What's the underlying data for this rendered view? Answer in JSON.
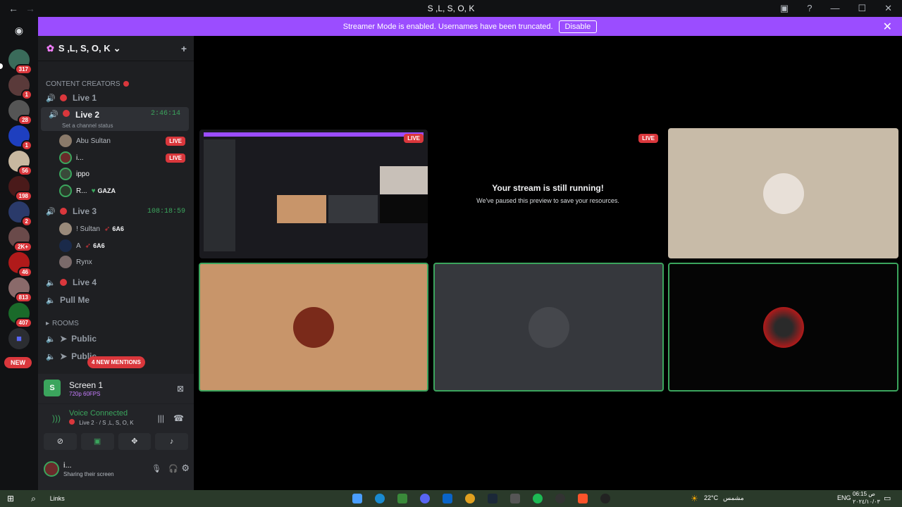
{
  "window": {
    "title": "S ,L, S, O, K"
  },
  "banner": {
    "text": "Streamer Mode is enabled. Usernames have been truncated.",
    "disable": "Disable"
  },
  "servers": {
    "badges": [
      "317",
      "1",
      "28",
      "1",
      "56",
      "198",
      "2",
      "2K+",
      "46",
      "813",
      "407"
    ],
    "new": "NEW"
  },
  "guild": {
    "name": "S ,L, S, O, K"
  },
  "sidebar": {
    "category": "CONTENT CREATORS",
    "rooms": "ROOMS",
    "channels": [
      {
        "name": "Live 1"
      },
      {
        "name": "Live 2",
        "timer": "2:46:14",
        "status": "Set a channel status"
      },
      {
        "name": "Live 3",
        "timer": "108:18:59"
      },
      {
        "name": "Live 4"
      },
      {
        "name": "Pull Me"
      },
      {
        "name": "Public"
      },
      {
        "name": "Public"
      }
    ],
    "users_live2": [
      {
        "name": "Abu Sultan",
        "badge": "LIVE"
      },
      {
        "name": "i...",
        "badge": "LIVE"
      },
      {
        "name": "ippo"
      },
      {
        "name": "R...",
        "tag": "GAZA"
      }
    ],
    "users_live3": [
      {
        "name": "! Sultan",
        "tag": "6A6"
      },
      {
        "name": "A",
        "tag": "6A6"
      },
      {
        "name": "Rynx"
      }
    ],
    "mentions": "4 NEW MENTIONS"
  },
  "panel": {
    "screen": "Screen 1",
    "quality": "720p 60FPS",
    "voice": "Voice Connected",
    "voice_channel": "Live 2 · / S ,L, S, O, K",
    "user": "i...",
    "user_status": "Sharing their screen"
  },
  "stage": {
    "paused_title": "Your stream is still running!",
    "paused_sub": "We've paused this preview to save your resources.",
    "live": "LIVE"
  },
  "taskbar": {
    "links": "Links",
    "temp": "22°C",
    "weather": "مشمس",
    "lang": "ENG",
    "time": "06:15 ص",
    "date": "٢٠٢٤/١٠/٠٣"
  }
}
